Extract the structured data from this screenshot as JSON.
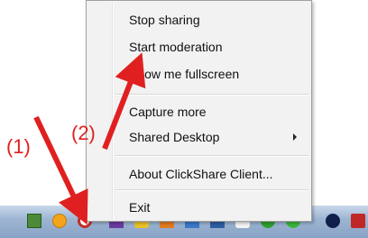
{
  "menu": {
    "items": {
      "stop_sharing": "Stop sharing",
      "start_moderation": "Start moderation",
      "show_fullscreen": "Show me fullscreen",
      "capture_more": "Capture more",
      "shared_desktop": "Shared Desktop",
      "about": "About ClickShare Client...",
      "exit": "Exit"
    }
  },
  "annotations": {
    "step1": "(1)",
    "step2": "(2)",
    "arrow_color": "#e02020"
  },
  "tray_icons": [
    "settings-icon",
    "update-icon",
    "clickshare-icon",
    "app-icon-purple",
    "app-icon-yellow",
    "app-icon-orange",
    "app-icon-blue",
    "app-icon-network",
    "app-icon-white",
    "app-icon-green",
    "app-icon-green-2",
    "bluetooth-icon",
    "shield-icon"
  ]
}
